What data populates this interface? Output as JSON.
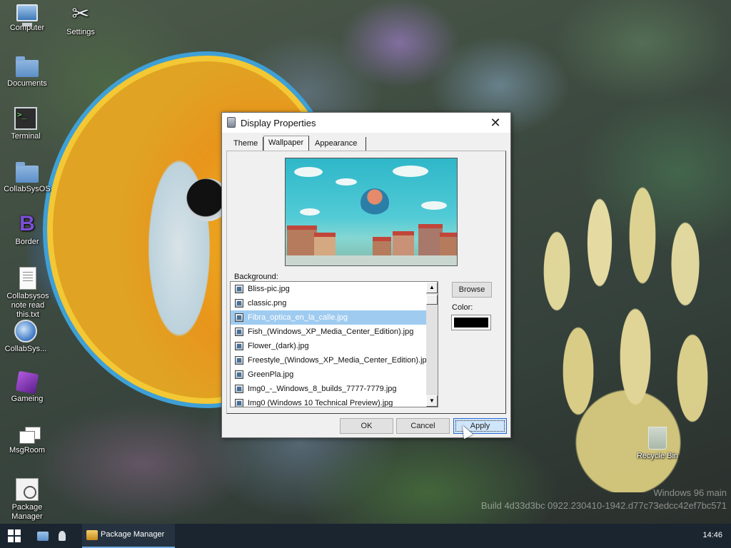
{
  "desktop": {
    "icons": [
      {
        "label": "Computer",
        "icon": "computer-icon"
      },
      {
        "label": "Settings",
        "icon": "settings-icon"
      },
      {
        "label": "Documents",
        "icon": "folder-icon"
      },
      {
        "label": "Terminal",
        "icon": "terminal-icon"
      },
      {
        "label": "CollabSysOS",
        "icon": "folder-icon"
      },
      {
        "label": "Border",
        "icon": "border-app-icon"
      },
      {
        "label": "Collabsysos note read this.txt",
        "icon": "text-file-icon"
      },
      {
        "label": "CollabSys...",
        "icon": "globe-icon"
      },
      {
        "label": "Gameing",
        "icon": "cube-icon"
      },
      {
        "label": "MsgRoom",
        "icon": "msgroom-icon"
      },
      {
        "label": "Package Manager",
        "icon": "package-icon"
      },
      {
        "label": "Recycle Bin",
        "icon": "recycle-bin-icon"
      }
    ],
    "watermark": {
      "line1": "Windows 96 main",
      "line2": "Build 4d33d3bc 0922.230410-1942.d77c73edcc42ef7bc571"
    }
  },
  "dialog": {
    "title": "Display Properties",
    "close_glyph": "✕",
    "tabs": [
      {
        "label": "Theme",
        "active": false
      },
      {
        "label": "Wallpaper",
        "active": true
      },
      {
        "label": "Appearance",
        "active": false
      }
    ],
    "background_label": "Background:",
    "files": [
      {
        "name": "Bliss-pic.jpg",
        "selected": false
      },
      {
        "name": "classic.png",
        "selected": false
      },
      {
        "name": "Fibra_optica_en_la_calle.jpg",
        "selected": true
      },
      {
        "name": "Fish_(Windows_XP_Media_Center_Edition).jpg",
        "selected": false
      },
      {
        "name": "Flower_(dark).jpg",
        "selected": false
      },
      {
        "name": "Freestyle_(Windows_XP_Media_Center_Edition).jpg",
        "selected": false
      },
      {
        "name": "GreenPla.jpg",
        "selected": false
      },
      {
        "name": "Img0_-_Windows_8_builds_7777-7779.jpg",
        "selected": false
      },
      {
        "name": "Img0 (Windows 10 Technical Preview).jpg",
        "selected": false
      }
    ],
    "browse_label": "Browse",
    "color_label": "Color:",
    "color_value": "#000000",
    "ok_label": "OK",
    "cancel_label": "Cancel",
    "apply_label": "Apply"
  },
  "taskbar": {
    "task_label": "Package Manager",
    "clock": "14:46"
  }
}
